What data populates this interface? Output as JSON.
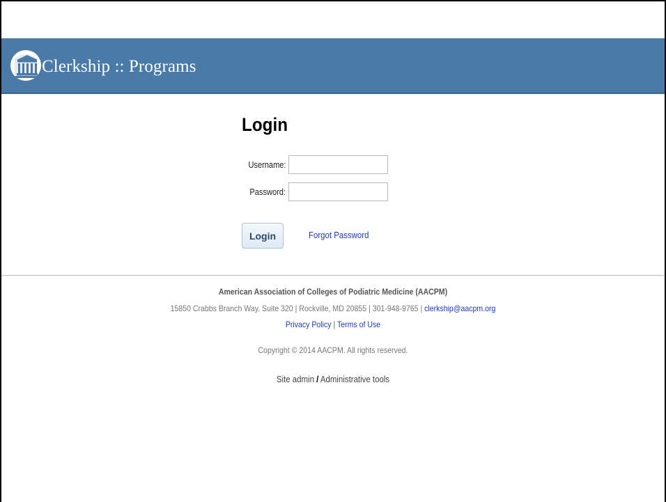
{
  "header": {
    "title": "Clerkship :: Programs",
    "logo_icon": "columns-building-icon",
    "background_color": "#4a7aa8"
  },
  "login": {
    "title": "Login",
    "username_label": "Username:",
    "username_value": "",
    "password_label": "Password:",
    "password_value": "",
    "button_label": "Login",
    "forgot_link": "Forgot Password"
  },
  "footer": {
    "org_name": "American Association of Colleges of Podiatric Medicine (AACPM)",
    "address": "15850 Crabbs Branch Way, Suite 320 | Rockville, MD 20855 | 301-948-9765 | ",
    "email": "clerkship@aacpm.org",
    "privacy_policy": "Privacy Policy",
    "separator": "|",
    "terms_of_use": "Terms of Use",
    "copyright": "Copyright © 2014 AACPM. All rights reserved.",
    "site_admin": "Site admin",
    "admin_separator": "/",
    "admin_tools": "Administrative tools"
  },
  "colors": {
    "link": "#1f3ab5",
    "header": "#4a7aa8",
    "button_text": "#2b4966"
  }
}
